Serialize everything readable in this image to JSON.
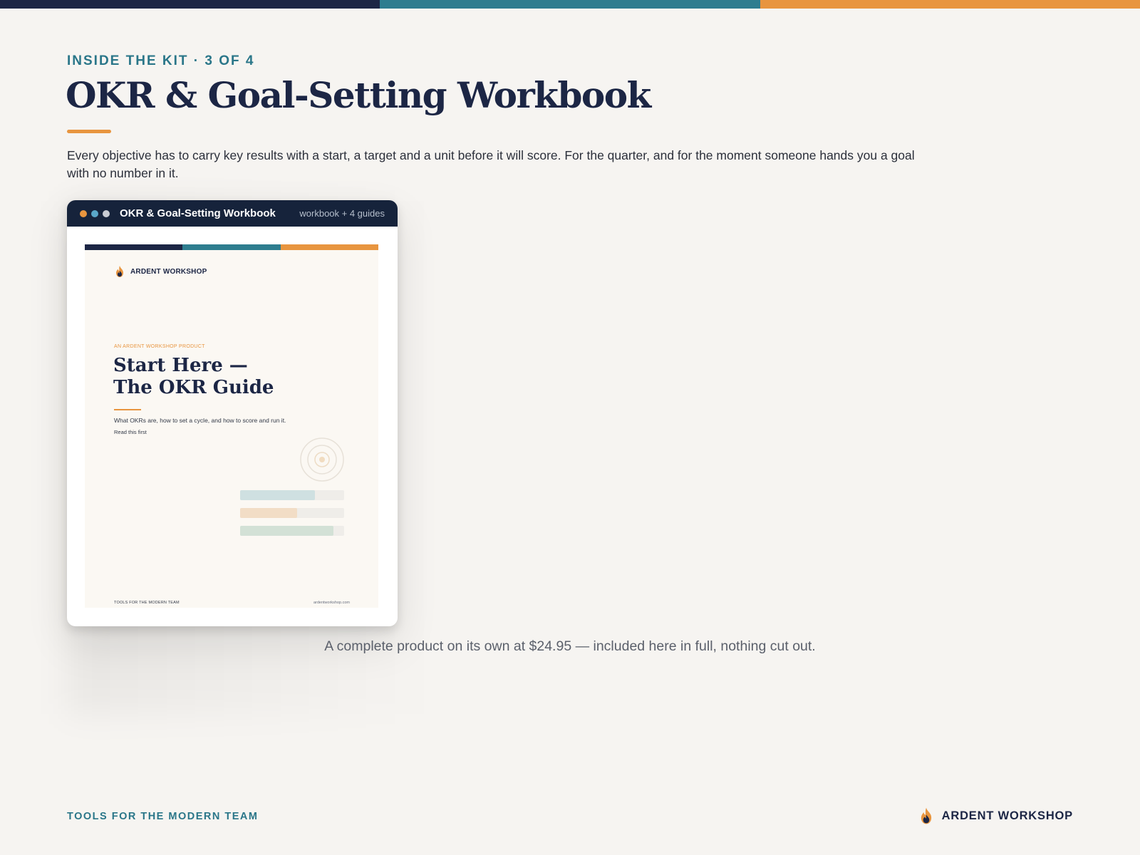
{
  "colors": {
    "navy": "#1c2645",
    "teal": "#2e7d8f",
    "orange": "#e8953f",
    "background": "#f6f4f1"
  },
  "header": {
    "kicker": "INSIDE THE KIT · 3 OF 4",
    "title": "OKR & Goal-Setting Workbook",
    "lede": "Every objective has to carry key results with a start, a target and a unit before it will score. For the quarter, and for the moment someone hands you a goal with no number in it."
  },
  "card": {
    "title": "OKR & Goal-Setting Workbook",
    "tag": "workbook + 4 guides",
    "window_dots": [
      "#e8953f",
      "#5aa7c9",
      "#c9ccd3"
    ],
    "preview": {
      "brand": "ARDENT WORKSHOP",
      "kicker": "AN ARDENT WORKSHOP PRODUCT",
      "title_line1": "Start Here —",
      "title_line2": "The OKR Guide",
      "description": "What OKRs are, how to set a cycle, and how to score and run it.",
      "note": "Read this first",
      "progress_bars": [
        {
          "fraction": 0.72,
          "color": "#cfe0e1"
        },
        {
          "fraction": 0.55,
          "color": "#f2ddc6"
        },
        {
          "fraction": 0.9,
          "color": "#d3e1d6"
        }
      ],
      "footer_left": "TOOLS FOR THE MODERN TEAM",
      "footer_right": "ardentworkshop.com"
    }
  },
  "caption": "A complete product on its own at $24.95 — included here in full, nothing cut out.",
  "footer": {
    "tagline": "TOOLS FOR THE MODERN TEAM",
    "brand": "ARDENT WORKSHOP"
  }
}
